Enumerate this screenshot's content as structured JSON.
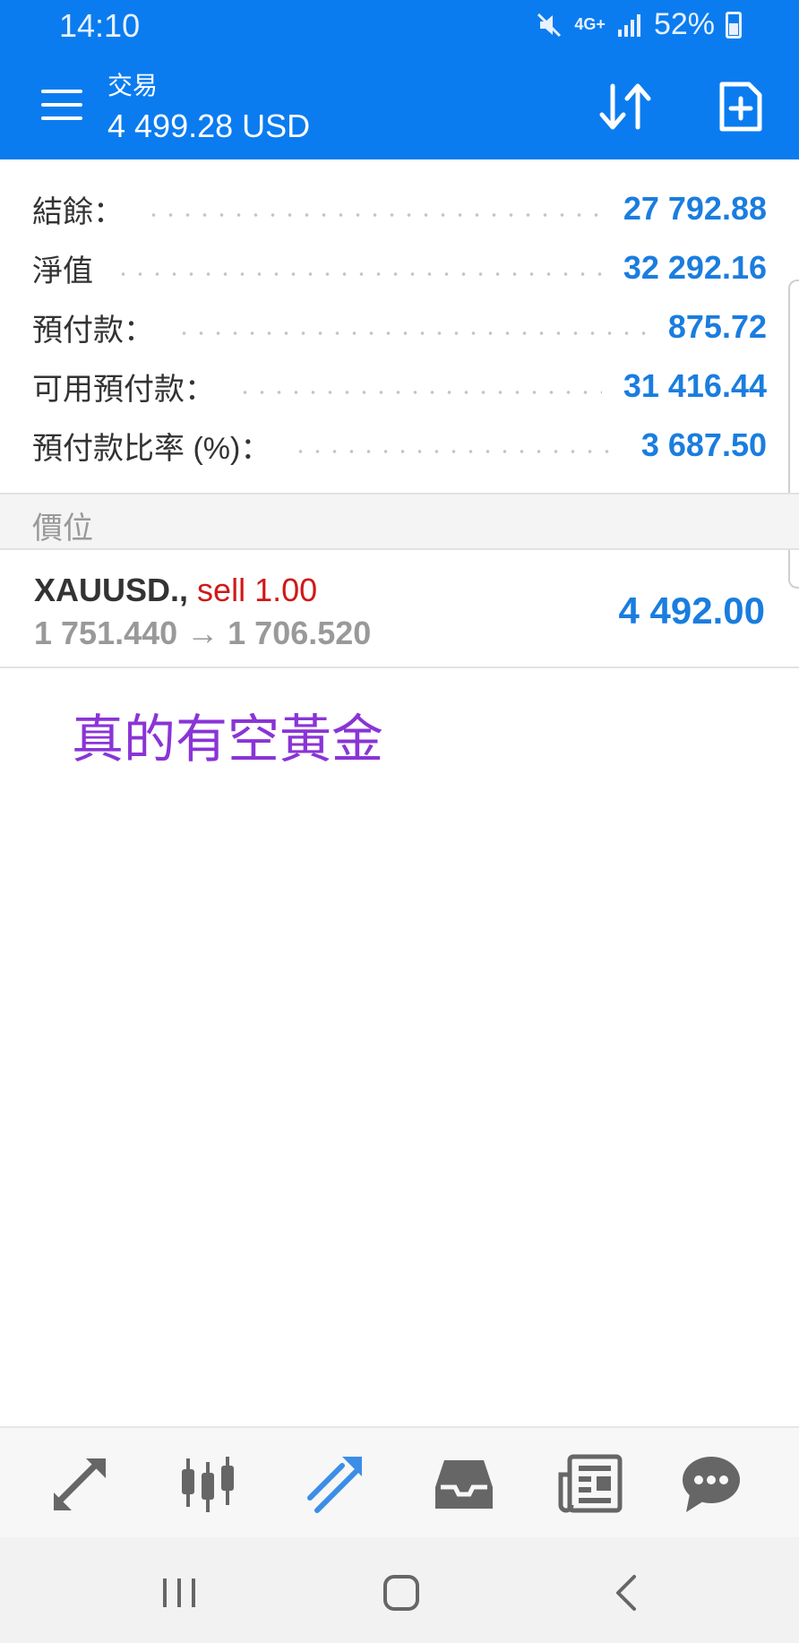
{
  "status_bar": {
    "time": "14:10",
    "network": "4G+",
    "battery": "52%"
  },
  "header": {
    "title": "交易",
    "balance": "4 499.28 USD",
    "icons": [
      "menu-icon",
      "sort-icon",
      "new-order-icon"
    ]
  },
  "account": {
    "rows": [
      {
        "label": "結餘：",
        "value": "27 792.88"
      },
      {
        "label": "淨值",
        "value": "32 292.16"
      },
      {
        "label": "預付款：",
        "value": "875.72"
      },
      {
        "label": "可用預付款：",
        "value": "31 416.44"
      },
      {
        "label": "預付款比率 (%)：",
        "value": "3 687.50"
      }
    ]
  },
  "positions_section": {
    "header": "價位"
  },
  "position": {
    "symbol": "XAUUSD.,",
    "side": "sell 1.00",
    "prices": "1 751.440 → 1 706.520",
    "profit": "4 492.00"
  },
  "note": "真的有空黃金",
  "bottom_nav": {
    "items": [
      "quotes-icon",
      "chart-icon",
      "trade-icon",
      "history-icon",
      "news-icon",
      "chat-icon"
    ],
    "active": "trade-icon"
  },
  "colors": {
    "header_bg": "#0a7cf0",
    "value_blue": "#1a7ddf",
    "sell_red": "#d01818",
    "note_purple": "#8a34d6"
  }
}
